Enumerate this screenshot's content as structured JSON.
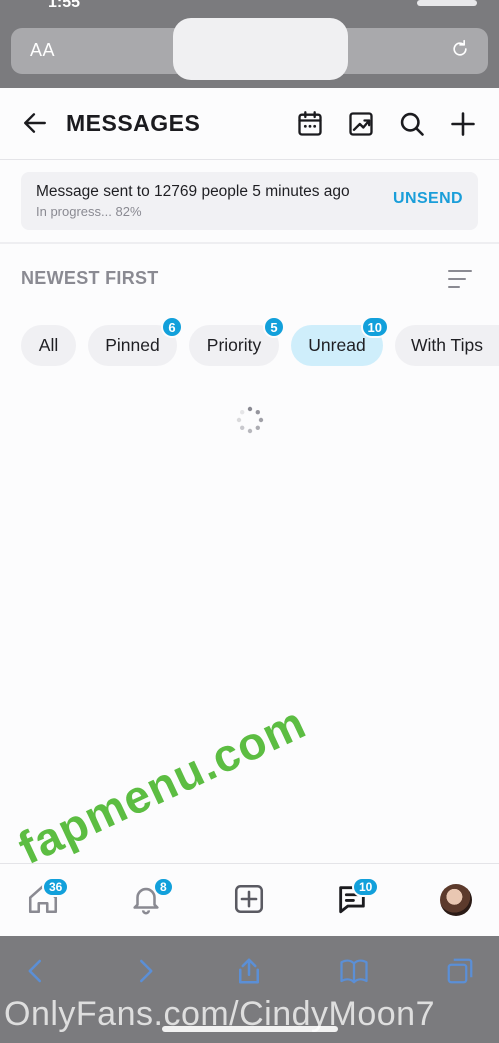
{
  "statusbar": {
    "time": "1:55"
  },
  "browser": {
    "text_size_label": "AA"
  },
  "header": {
    "title": "MESSAGES"
  },
  "notice": {
    "message": "Message sent to 12769 people 5 minutes ago",
    "progress_text": "In progress... 82%",
    "progress_percent": 82,
    "action_label": "UNSEND"
  },
  "sort": {
    "label": "NEWEST FIRST"
  },
  "filters": [
    {
      "label": "All",
      "badge": ""
    },
    {
      "label": "Pinned",
      "badge": "6"
    },
    {
      "label": "Priority",
      "badge": "5"
    },
    {
      "label": "Unread",
      "badge": "10",
      "active": true
    },
    {
      "label": "With Tips",
      "badge": ""
    }
  ],
  "tabbar": {
    "home_badge": "36",
    "notifications_badge": "8",
    "messages_badge": "10"
  },
  "watermarks": {
    "site": "fapmenu.com",
    "profile": "OnlyFans.com/CindyMoon7"
  },
  "colors": {
    "accent": "#12a0db",
    "active_chip": "#cfeefb",
    "watermark_green": "#46b428"
  }
}
